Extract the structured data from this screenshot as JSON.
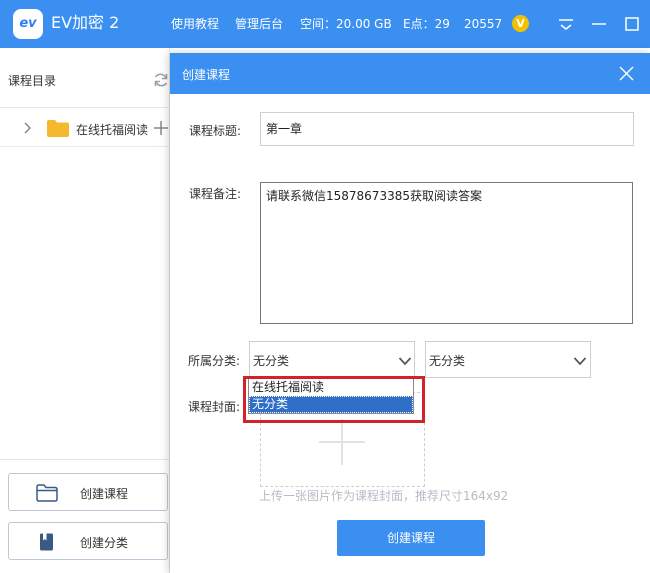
{
  "app": {
    "logo_text": "ev",
    "title": "EV加密 2",
    "nav": [
      "使用教程",
      "管理后台"
    ],
    "space_label": "空间：20.00 GB",
    "points_label": "E点：29",
    "user_id": "20557",
    "vip_badge": "V",
    "accent_color": "#3a8ff0"
  },
  "sidebar": {
    "title": "课程目录",
    "tree": [
      {
        "label": "在线托福阅读",
        "expanded": false
      }
    ],
    "buttons": [
      {
        "label": "创建课程",
        "icon": "folder-outline-icon"
      },
      {
        "label": "创建分类",
        "icon": "book-icon"
      }
    ]
  },
  "modal": {
    "title": "创建课程",
    "fields": {
      "title_label": "课程标题:",
      "title_value": "第一章",
      "note_label": "课程备注:",
      "note_value": "请联系微信15878673385获取阅读答案",
      "category_label": "所属分类:",
      "category_value": "无分类",
      "subcategory_value": "无分类",
      "cover_label": "课程封面:"
    },
    "dropdown_options": [
      {
        "label": "在线托福阅读",
        "selected": false
      },
      {
        "label": "无分类",
        "selected": true
      }
    ],
    "cover_hint": "上传一张图片作为课程封面，推荐尺寸164x92",
    "submit_label": "创建课程",
    "highlight_color": "#d2232a"
  }
}
